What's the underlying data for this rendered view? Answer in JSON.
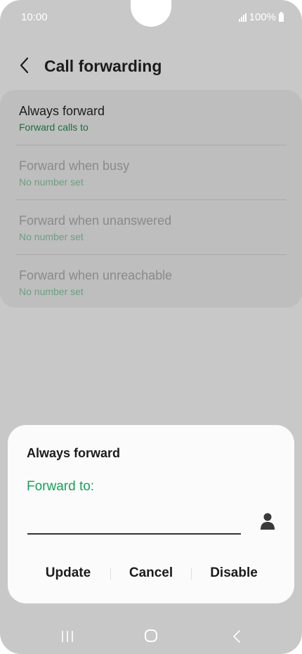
{
  "status_bar": {
    "time": "10:00",
    "battery": "100%"
  },
  "header": {
    "title": "Call forwarding"
  },
  "options": [
    {
      "title": "Always forward",
      "subtitle": "Forward calls to",
      "enabled": true
    },
    {
      "title": "Forward when busy",
      "subtitle": "No number set",
      "enabled": false
    },
    {
      "title": "Forward when unanswered",
      "subtitle": "No number set",
      "enabled": false
    },
    {
      "title": "Forward when unreachable",
      "subtitle": "No number set",
      "enabled": false
    }
  ],
  "dialog": {
    "title": "Always forward",
    "label": "Forward to:",
    "input_value": "",
    "buttons": {
      "update": "Update",
      "cancel": "Cancel",
      "disable": "Disable"
    }
  },
  "colors": {
    "accent_green": "#1aa05a",
    "scrim_gray": "#c8c8c8"
  },
  "icons": {
    "back": "chevron-left-icon",
    "contact": "person-icon",
    "nav_recents": "recents-icon",
    "nav_home": "home-icon",
    "nav_back": "back-icon"
  }
}
